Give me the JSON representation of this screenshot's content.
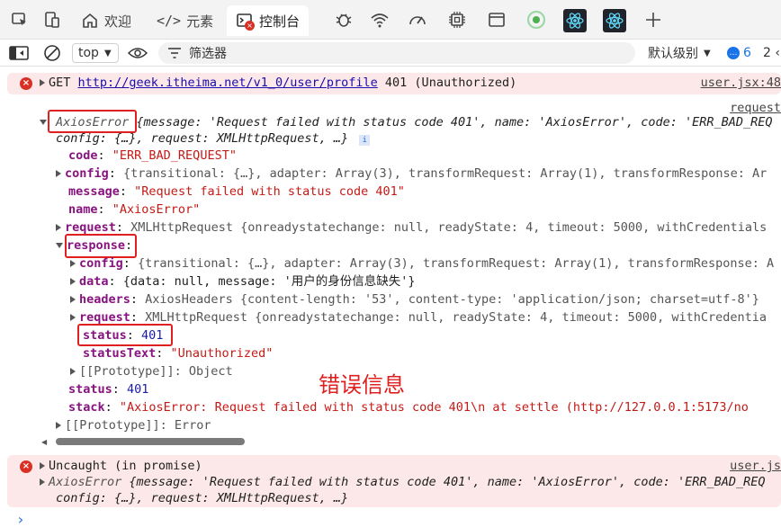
{
  "tabs": {
    "welcome": "欢迎",
    "elements": "元素",
    "console": "控制台"
  },
  "toolbar": {
    "context": "top",
    "filter_placeholder": "筛选器",
    "levels": "默认级别",
    "issues_count": "6",
    "extra": "2 ‹"
  },
  "error1": {
    "method": "GET",
    "url": "http://geek.itheima.net/v1_0/user/profile",
    "status": "401 (Unauthorized)",
    "source": "user.jsx:48",
    "source2": "request",
    "summary_type": "AxiosError",
    "summary_rest": " {message: 'Request failed with status code 401', name: 'AxiosError', code: 'ERR_BAD_REQ",
    "summary_line2": "config: {…}, request: XMLHttpRequest, …}",
    "code_key": "code",
    "code_val": "\"ERR_BAD_REQUEST\"",
    "config_key": "config",
    "config_val": "{transitional: {…}, adapter: Array(3), transformRequest: Array(1), transformResponse: Ar",
    "message_key": "message",
    "message_val": "\"Request failed with status code 401\"",
    "name_key": "name",
    "name_val": "\"AxiosError\"",
    "request_key": "request",
    "request_val": "XMLHttpRequest {onreadystatechange: null, readyState: 4, timeout: 5000, withCredentials",
    "response_key": "response",
    "resp_config_key": "config",
    "resp_config_val": "{transitional: {…}, adapter: Array(3), transformRequest: Array(1), transformResponse: A",
    "resp_data_key": "data",
    "resp_data_val": "{data: null, message: '用户的身份信息缺失'}",
    "resp_headers_key": "headers",
    "resp_headers_val": "AxiosHeaders {content-length: '53', content-type: 'application/json; charset=utf-8'}",
    "resp_request_key": "request",
    "resp_request_val": "XMLHttpRequest {onreadystatechange: null, readyState: 4, timeout: 5000, withCredentia",
    "resp_status_key": "status",
    "resp_status_val": "401",
    "resp_statustext_key": "statusText",
    "resp_statustext_val": "\"Unauthorized\"",
    "resp_proto": "[[Prototype]]: Object",
    "status_key": "status",
    "status_val": "401",
    "stack_key": "stack",
    "stack_val": "\"AxiosError: Request failed with status code 401\\n    at settle (http://127.0.0.1:5173/no",
    "proto": "[[Prototype]]: Error"
  },
  "annotation": "错误信息",
  "error2": {
    "title": "Uncaught (in promise)",
    "source": "user.js",
    "line1_type": "AxiosError",
    "line1_rest": " {message: 'Request failed with status code 401', name: 'AxiosError', code: 'ERR_BAD_REQ",
    "line2": "config: {…}, request: XMLHttpRequest, …}"
  },
  "prompt": "›"
}
